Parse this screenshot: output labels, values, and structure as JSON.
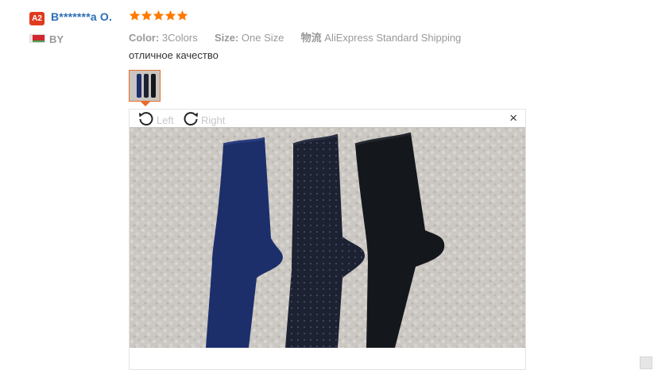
{
  "review": {
    "avatar_badge": "A2",
    "user_name": "B*******a O.",
    "rating": 5,
    "country_code": "BY",
    "meta": {
      "color_label": "Color:",
      "color_value": "3Colors",
      "size_label": "Size:",
      "size_value": "One Size",
      "shipping_label": "物流",
      "shipping_value": "AliExpress Standard Shipping"
    },
    "text": "отличное качество"
  },
  "viewer": {
    "rotate_left_label": "Left",
    "rotate_right_label": "Right",
    "close_glyph": "×"
  },
  "colors": {
    "name": "#2c6eb6",
    "star": "#ff7a00",
    "badge": "#e03a1e",
    "thumb_border": "#e86b2b",
    "sock_blue": "#1c2f6b",
    "sock_navy": "#1d2233",
    "sock_black": "#14181c"
  },
  "icons": [
    "star-icon",
    "flag-icon",
    "rotate-left-icon",
    "rotate-right-icon",
    "close-icon"
  ]
}
